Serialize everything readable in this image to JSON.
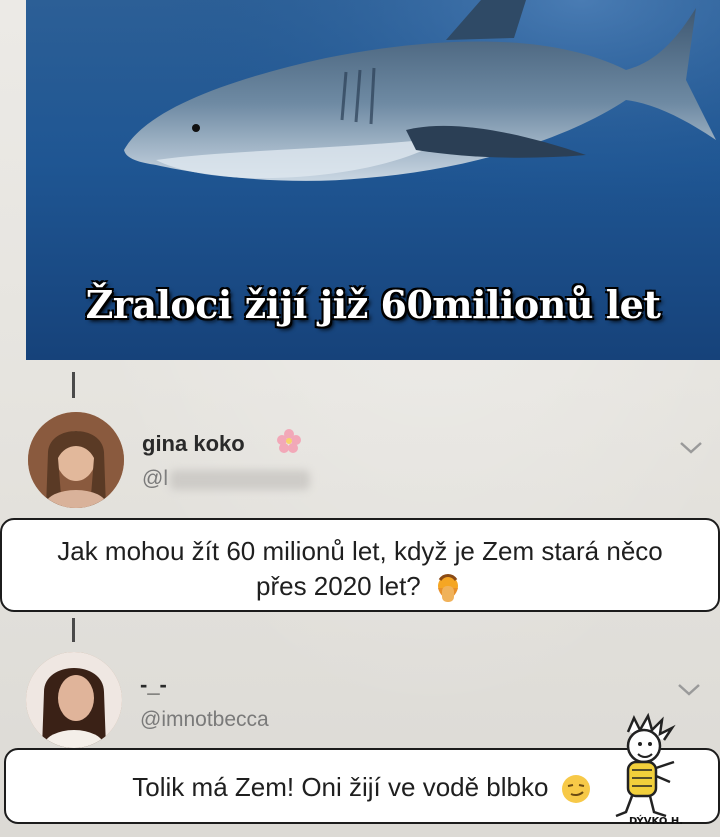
{
  "meme": {
    "caption": "Žraloci žijí již 60milionů let"
  },
  "comments": [
    {
      "name": "gina koko",
      "handle": "@l",
      "subtitle": "Jak mohou žít 60 milionů let, když je Zem stará něco přes 2020 let?",
      "emoji": "facepalm-emoji"
    },
    {
      "name": "-_-",
      "handle": "@imnotbecca",
      "subtitle": "Tolik má Zem! Oni žijí ve vodě blbko",
      "emoji": "smirk-emoji"
    }
  ],
  "watermark": {
    "text": "DÝVKO H."
  },
  "colors": {
    "ocean": "#1f5693",
    "card_border": "#1c1c1c",
    "pink_flower": "#f2a8b8"
  }
}
